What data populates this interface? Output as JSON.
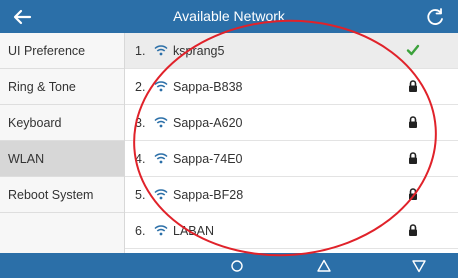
{
  "header": {
    "title": "Available Network",
    "back_icon": "back-arrow-icon",
    "refresh_icon": "refresh-icon"
  },
  "sidebar": {
    "items": [
      {
        "label": "UI Preference"
      },
      {
        "label": "Ring & Tone"
      },
      {
        "label": "Keyboard"
      },
      {
        "label": "WLAN"
      },
      {
        "label": "Reboot System"
      }
    ],
    "active": "WLAN"
  },
  "networks": [
    {
      "num": "1.",
      "ssid": "ksprang5",
      "status": "connected"
    },
    {
      "num": "2.",
      "ssid": "Sappa-B838",
      "status": "secured"
    },
    {
      "num": "3.",
      "ssid": "Sappa-A620",
      "status": "secured"
    },
    {
      "num": "4.",
      "ssid": "Sappa-74E0",
      "status": "secured"
    },
    {
      "num": "5.",
      "ssid": "Sappa-BF28",
      "status": "secured"
    },
    {
      "num": "6.",
      "ssid": "LABAN",
      "status": "secured"
    }
  ],
  "footer": {
    "softkeys": [
      "circle-icon",
      "triangle-up-icon",
      "triangle-down-icon"
    ]
  },
  "colors": {
    "header": "#2b6fa8",
    "wifi": "#2b6fa8",
    "check": "#3ca23c",
    "annotation": "#e0222a"
  }
}
